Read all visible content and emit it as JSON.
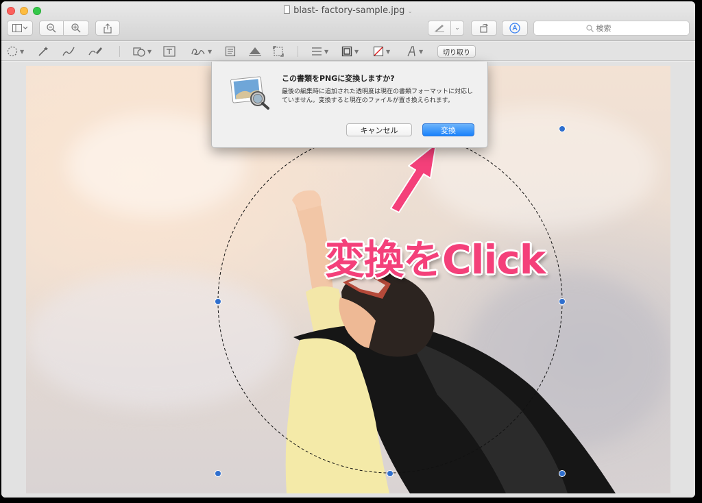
{
  "window": {
    "title": "blast- factory-sample.jpg"
  },
  "toolbar": {
    "search_placeholder": "検索",
    "crop_label": "切り取り"
  },
  "dialog": {
    "title": "この書類をPNGに変換しますか?",
    "message": "最後の編集時に追加された透明度は現在の書類フォーマットに対応していません。変換すると現在のファイルが置き換えられます。",
    "cancel_label": "キャンセル",
    "convert_label": "変換"
  },
  "annotation": {
    "text": "変換をClick",
    "color": "#f4407a"
  },
  "colors": {
    "accent": "#1a82fb",
    "selection_handle": "#2f6fce"
  },
  "icons": {
    "toolbar": [
      "sidebar-icon",
      "zoom-out-icon",
      "zoom-in-icon",
      "share-icon",
      "pen-icon",
      "rotate-icon",
      "markup-icon",
      "search-icon"
    ],
    "markup": [
      "selection-icon",
      "magic-wand-icon",
      "sketch-icon",
      "draw-icon",
      "shapes-icon",
      "text-icon",
      "signature-icon",
      "note-icon",
      "adjust-color-icon",
      "adjust-size-icon",
      "line-style-icon",
      "border-color-icon",
      "fill-color-icon",
      "text-style-icon"
    ]
  }
}
